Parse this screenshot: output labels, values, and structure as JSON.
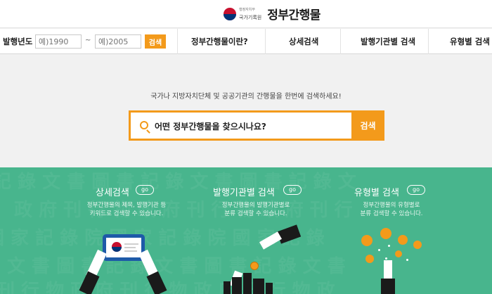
{
  "header": {
    "org_sub": "행정자치부",
    "org_main": "국가기록원",
    "site_title": "정부간행물"
  },
  "navbar": {
    "year_label": "발행년도",
    "year_from_placeholder": "예)1990",
    "tilde": "~",
    "year_to_placeholder": "예)2005",
    "year_search_label": "검색",
    "items": [
      {
        "label": "정부간행물이란?"
      },
      {
        "label": "상세검색"
      },
      {
        "label": "발행기관별 검색"
      },
      {
        "label": "유형별 검색"
      }
    ]
  },
  "hero": {
    "description": "국가나 지방자치단체 및 공공기관의 간행물을 한번에 검색하세요!",
    "search_placeholder": "어떤 정부간행물을 찾으시나요?",
    "search_button": "검색"
  },
  "features": [
    {
      "title": "상세검색",
      "go": "go",
      "desc_line1": "정부간행물의 제목, 발행기관 등",
      "desc_line2": "키워드로 검색할 수 있습니다."
    },
    {
      "title": "발행기관별 검색",
      "go": "go",
      "desc_line1": "정부간행물의 발행기관별로",
      "desc_line2": "분류 검색할 수 있습니다."
    },
    {
      "title": "유형별 검색",
      "go": "go",
      "desc_line1": "정부간행물의 유형별로",
      "desc_line2": "분류 검색할 수 있습니다."
    }
  ],
  "colors": {
    "accent": "#f39a1b",
    "green": "#48b58d"
  }
}
